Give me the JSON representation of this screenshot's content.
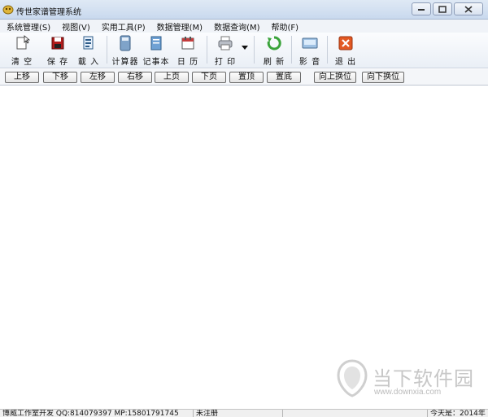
{
  "window": {
    "title": "传世家谱管理系统",
    "icon": "family-tree-app-icon"
  },
  "menu": [
    {
      "label": "系统管理(S)"
    },
    {
      "label": "视图(V)"
    },
    {
      "label": "实用工具(P)"
    },
    {
      "label": "数据管理(M)"
    },
    {
      "label": "数据查询(M)"
    },
    {
      "label": "帮助(F)"
    }
  ],
  "toolbar": {
    "clear": "清 空",
    "save": "保 存",
    "load": "載 入",
    "calculator": "计算器",
    "notepad": "记事本",
    "calendar": "日 历",
    "print": "打 印",
    "refresh": "刷 新",
    "media": "影 音",
    "exit": "退 出"
  },
  "nav_buttons": [
    {
      "label": "上移"
    },
    {
      "label": "下移"
    },
    {
      "label": "左移"
    },
    {
      "label": "右移"
    },
    {
      "label": "上页"
    },
    {
      "label": "下页"
    },
    {
      "label": "置顶"
    },
    {
      "label": "置底"
    },
    {
      "label": "向上换位"
    },
    {
      "label": "向下换位"
    }
  ],
  "statusbar": {
    "developer": "博威工作室开发 QQ:814079397 MP:15801791745",
    "registration": "未注册",
    "date": "今天是：2014年"
  },
  "watermark": {
    "brand": "当下软件园",
    "url": "www.downxia.com"
  },
  "colors": {
    "titlebar": "#c9d9ee",
    "close_icon": "#e25822",
    "refresh_icon": "#3aa33a",
    "save_icon": "#b01c1c"
  }
}
